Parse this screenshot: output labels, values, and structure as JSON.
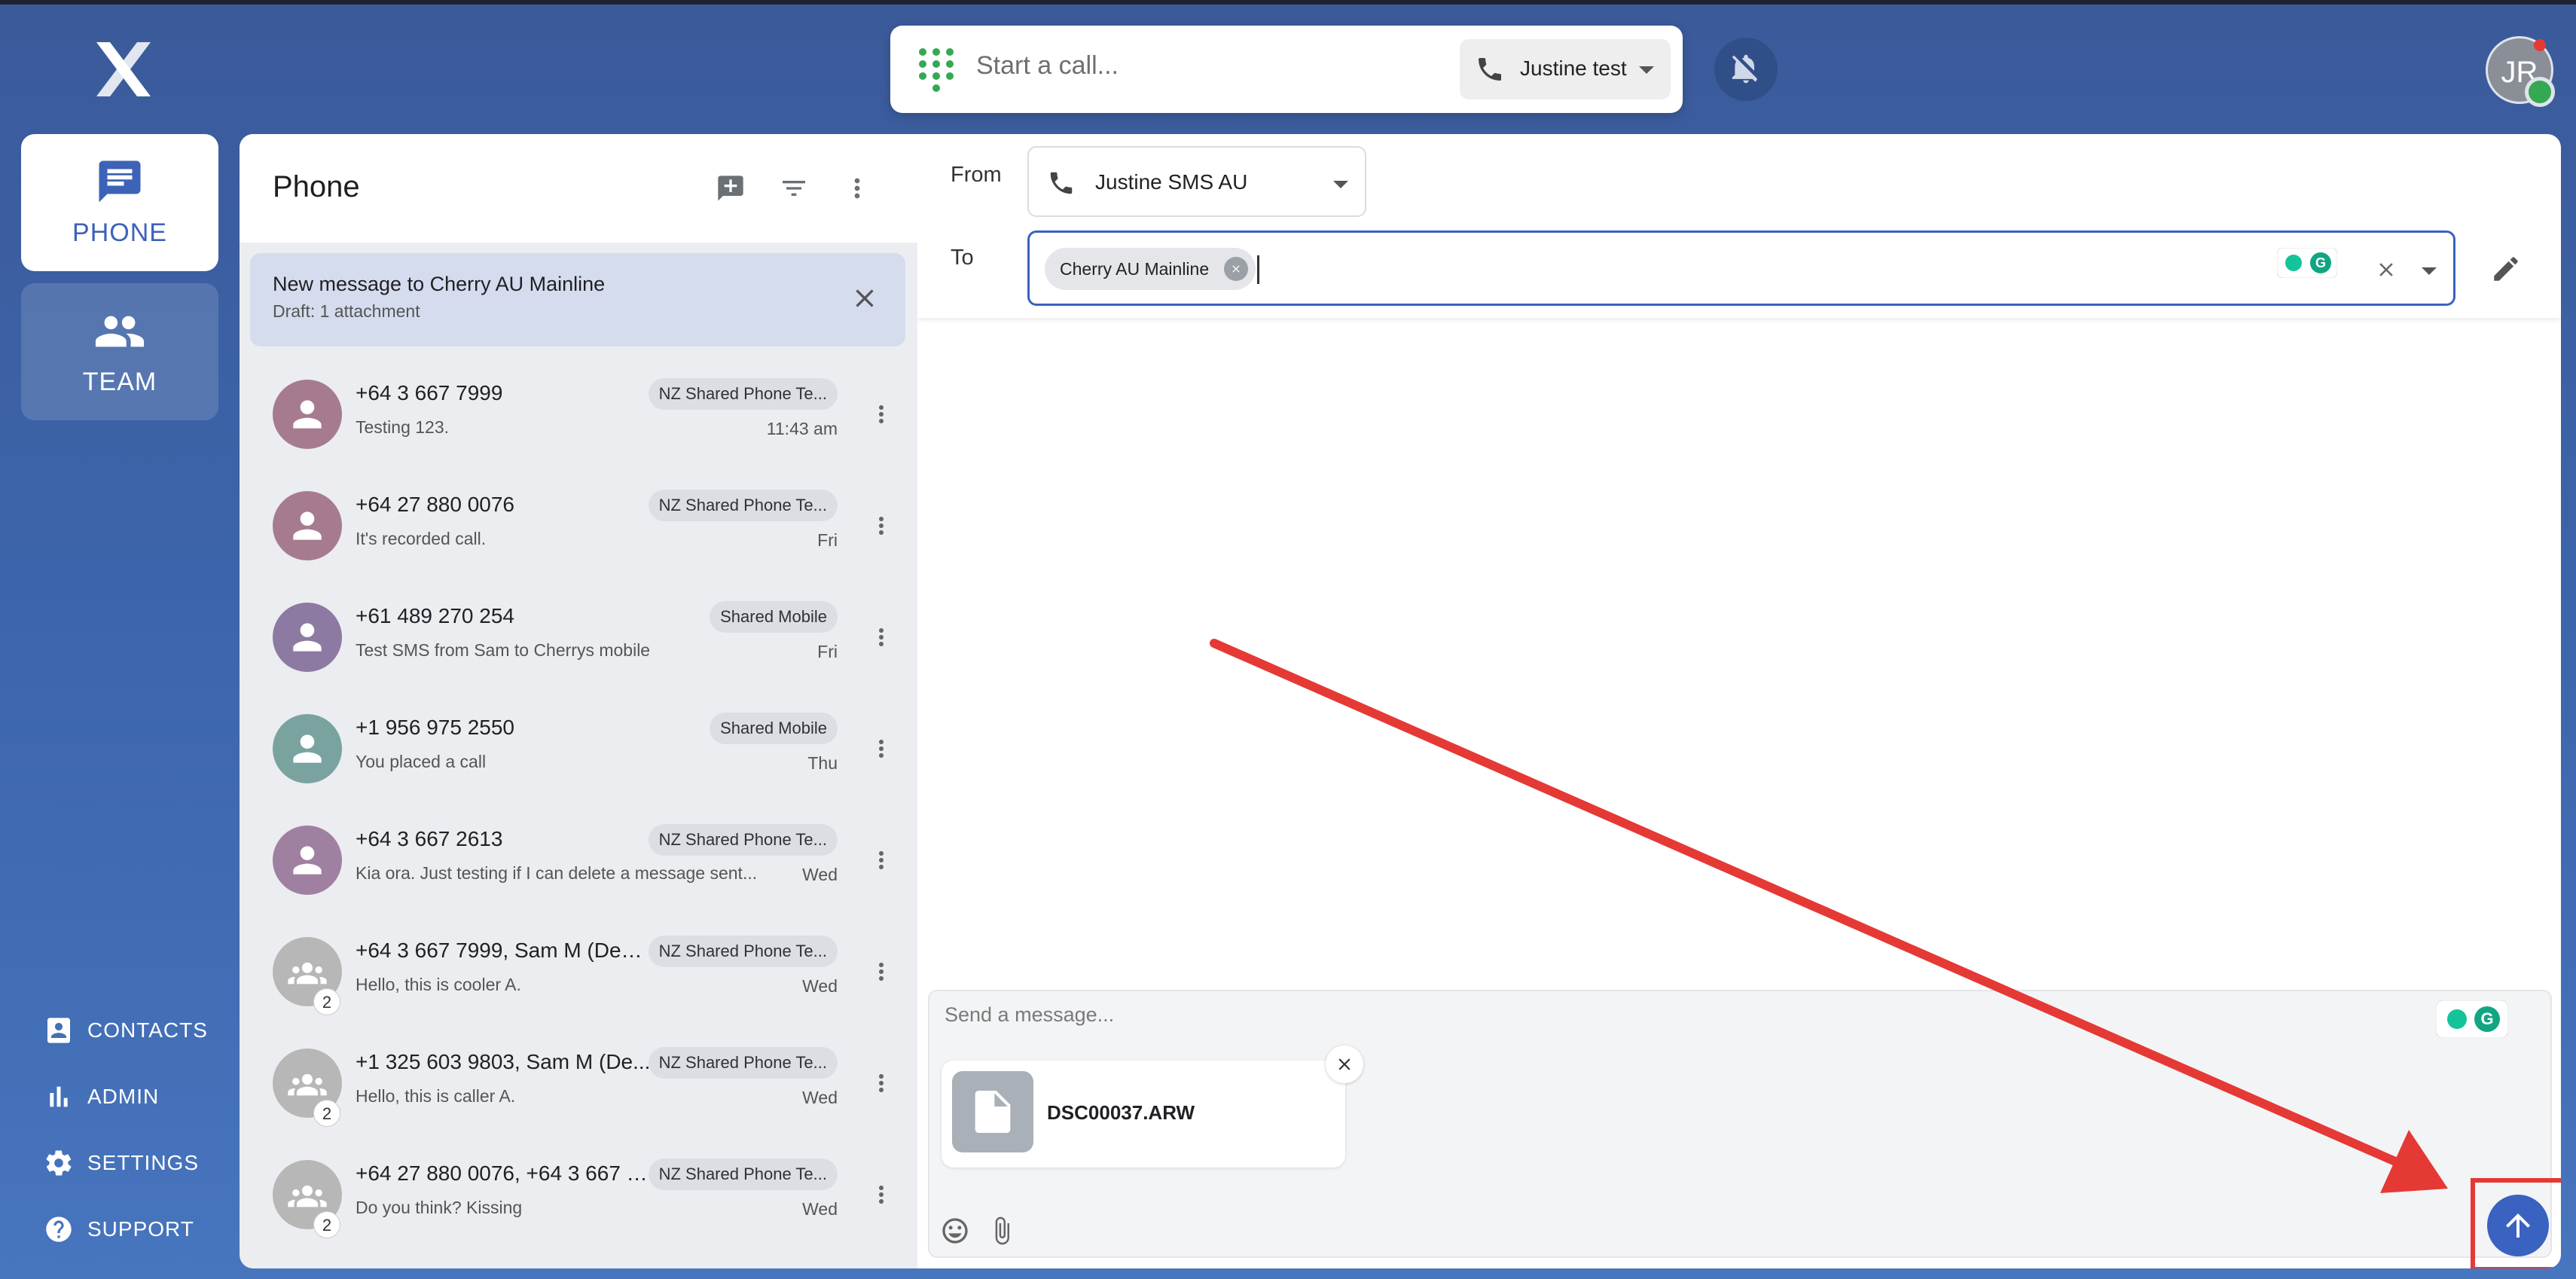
{
  "app": {
    "logo": "X"
  },
  "topbar": {
    "call_placeholder": "Start a call...",
    "line_name": "Justine test",
    "avatar_initials": "JR"
  },
  "nav": {
    "phone_label": "PHONE",
    "team_label": "TEAM",
    "contacts_label": "CONTACTS",
    "admin_label": "ADMIN",
    "settings_label": "SETTINGS",
    "support_label": "SUPPORT"
  },
  "list": {
    "title": "Phone",
    "draft": {
      "title": "New message to Cherry AU Mainline",
      "subtitle": "Draft: 1 attachment"
    },
    "conversations": [
      {
        "name": "+64 3 667 7999",
        "line": "NZ Shared Phone Te...",
        "snippet": "Testing 123.",
        "time": "11:43 am",
        "group": false,
        "color": "#a77b8f"
      },
      {
        "name": "+64 27 880 0076",
        "line": "NZ Shared Phone Te...",
        "snippet": "It's recorded call.",
        "time": "Fri",
        "group": false,
        "color": "#a77b8f"
      },
      {
        "name": "+61 489 270 254",
        "line": "Shared Mobile",
        "snippet": "Test SMS from Sam to Cherrys mobile",
        "time": "Fri",
        "group": false,
        "color": "#8d7aa3"
      },
      {
        "name": "+1 956 975 2550",
        "line": "Shared Mobile",
        "snippet": "You placed a call",
        "time": "Thu",
        "group": false,
        "color": "#7aa3a0"
      },
      {
        "name": "+64 3 667 2613",
        "line": "NZ Shared Phone Te...",
        "snippet": "Kia ora. Just testing if I can delete a message sent...",
        "time": "Wed",
        "group": false,
        "color": "#a080a0"
      },
      {
        "name": "+64 3 667 7999, Sam M (Dem...",
        "line": "NZ Shared Phone Te...",
        "snippet": "Hello, this is cooler A.",
        "time": "Wed",
        "group": true,
        "count": "2",
        "color": "#b7b7b7"
      },
      {
        "name": "+1 325 603 9803, Sam M (De...",
        "line": "NZ Shared Phone Te...",
        "snippet": "Hello, this is caller A.",
        "time": "Wed",
        "group": true,
        "count": "2",
        "color": "#b7b7b7"
      },
      {
        "name": "+64 27 880 0076, +64 3 667 7...",
        "line": "NZ Shared Phone Te...",
        "snippet": "Do you think? Kissing",
        "time": "Wed",
        "group": true,
        "count": "2",
        "color": "#b7b7b7"
      }
    ]
  },
  "compose": {
    "from_label": "From",
    "from_value": "Justine SMS AU",
    "to_label": "To",
    "to_chip": "Cherry AU Mainline",
    "message_placeholder": "Send a message...",
    "attachment_name": "DSC00037.ARW"
  },
  "colors": {
    "accent": "#3a62c0",
    "annotation": "#e53935",
    "online": "#34a853"
  }
}
